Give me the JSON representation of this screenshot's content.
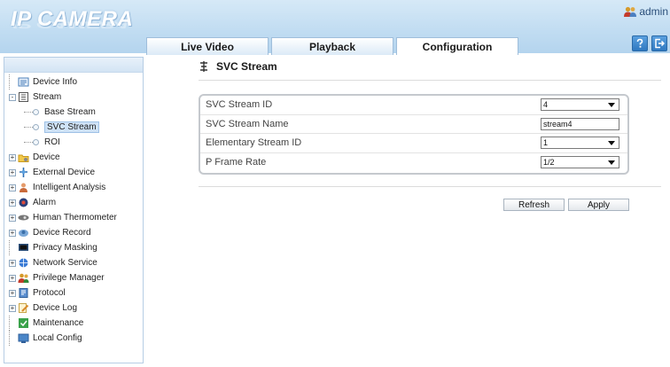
{
  "app": {
    "title": "IP CAMERA",
    "user": "admin"
  },
  "header": {
    "user_icon": "users-icon",
    "buttons": [
      {
        "name": "help-icon"
      },
      {
        "name": "logout-icon"
      }
    ]
  },
  "tabs": [
    {
      "label": "Live Video",
      "active": false
    },
    {
      "label": "Playback",
      "active": false
    },
    {
      "label": "Configuration",
      "active": true
    }
  ],
  "sidebar": {
    "items": [
      {
        "label": "Device Info",
        "icon": "device-info-icon",
        "expander": ""
      },
      {
        "label": "Stream",
        "icon": "stream-icon",
        "expander": "-"
      },
      {
        "label": "Base Stream",
        "child": true
      },
      {
        "label": "SVC Stream",
        "child": true,
        "selected": true
      },
      {
        "label": "ROI",
        "child": true
      },
      {
        "label": "Device",
        "icon": "device-icon",
        "expander": "+"
      },
      {
        "label": "External Device",
        "icon": "external-device-icon",
        "expander": "+"
      },
      {
        "label": "Intelligent Analysis",
        "icon": "intelligent-analysis-icon",
        "expander": "+"
      },
      {
        "label": "Alarm",
        "icon": "alarm-icon",
        "expander": "+"
      },
      {
        "label": "Human Thermometer",
        "icon": "thermometer-icon",
        "expander": "+"
      },
      {
        "label": "Device Record",
        "icon": "device-record-icon",
        "expander": "+"
      },
      {
        "label": "Privacy Masking",
        "icon": "privacy-masking-icon",
        "expander": ""
      },
      {
        "label": "Network Service",
        "icon": "network-service-icon",
        "expander": "+"
      },
      {
        "label": "Privilege Manager",
        "icon": "privilege-manager-icon",
        "expander": "+"
      },
      {
        "label": "Protocol",
        "icon": "protocol-icon",
        "expander": "+"
      },
      {
        "label": "Device Log",
        "icon": "device-log-icon",
        "expander": "+"
      },
      {
        "label": "Maintenance",
        "icon": "maintenance-icon",
        "expander": ""
      },
      {
        "label": "Local Config",
        "icon": "local-config-icon",
        "expander": ""
      }
    ]
  },
  "main": {
    "title": "SVC Stream",
    "fields": [
      {
        "label": "SVC Stream ID",
        "value": "4",
        "type": "select"
      },
      {
        "label": "SVC Stream Name",
        "value": "stream4",
        "type": "text"
      },
      {
        "label": "Elementary Stream ID",
        "value": "1",
        "type": "select"
      },
      {
        "label": "P Frame Rate",
        "value": "1/2",
        "type": "select"
      }
    ],
    "buttons": {
      "refresh": "Refresh",
      "apply": "Apply"
    }
  },
  "colors": {
    "header": "#c2ddf2",
    "accent": "#2f78c0",
    "selected": "#cfe2f6"
  }
}
